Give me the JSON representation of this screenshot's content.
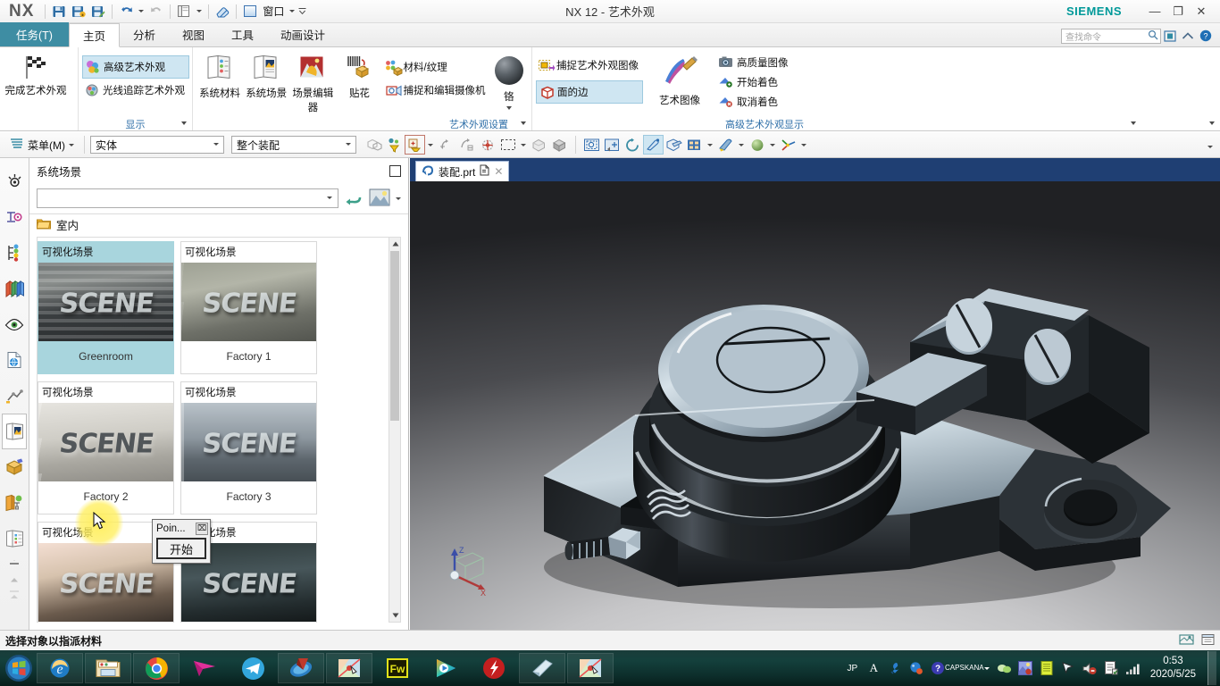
{
  "window": {
    "title": "NX 12 - 艺术外观",
    "brand": "SIEMENS",
    "app_name": "NX",
    "minimize": "—",
    "restore": "❐",
    "close": "✕"
  },
  "quick_access": [
    {
      "name": "save-icon",
      "label": "保存"
    },
    {
      "name": "save-as-icon",
      "label": "另存为"
    },
    {
      "name": "save-bookmark-icon",
      "label": "保存书签"
    },
    {
      "name": "undo-icon",
      "label": "撤销"
    },
    {
      "name": "redo-icon",
      "label": "重做"
    },
    {
      "name": "window-layout-icon",
      "label": "窗口布局"
    },
    {
      "name": "eraser-icon",
      "label": "擦除"
    }
  ],
  "window_menu": {
    "label": "窗口"
  },
  "tabs": {
    "task": "任务(T)",
    "items": [
      {
        "label": "主页",
        "active": true
      },
      {
        "label": "分析",
        "active": false
      },
      {
        "label": "视图",
        "active": false
      },
      {
        "label": "工具",
        "active": false
      },
      {
        "label": "动画设计",
        "active": false
      }
    ]
  },
  "search": {
    "placeholder": "查找命令"
  },
  "header_icons": [
    {
      "name": "full-screen-icon"
    },
    {
      "name": "collapse-ribbon-icon"
    },
    {
      "name": "help-icon"
    }
  ],
  "ribbon": {
    "groups": [
      {
        "label": "",
        "big_buttons": [
          {
            "name": "finish-studio-button",
            "label": "完成艺术外观",
            "icon": "checkered-flag-icon"
          }
        ]
      },
      {
        "label": "显示",
        "rows": [
          {
            "name": "advanced-studio-button",
            "label": "高级艺术外观",
            "icon": "spheres-icon",
            "selected": true
          },
          {
            "name": "raytrace-studio-button",
            "label": "光线追踪艺术外观",
            "icon": "raytrace-icon",
            "selected": false
          }
        ]
      },
      {
        "label": "艺术外观设置",
        "med_buttons": [
          {
            "name": "system-materials-button",
            "label": "系统材料",
            "icon": "material-library-icon"
          },
          {
            "name": "system-scenes-button",
            "label": "系统场景",
            "icon": "scene-library-icon"
          },
          {
            "name": "scene-editor-button",
            "label": "场景编辑器",
            "icon": "scene-editor-icon"
          },
          {
            "name": "decal-button",
            "label": "贴花",
            "icon": "decal-icon"
          }
        ],
        "rows": [
          {
            "name": "material-texture-button",
            "label": "材料/纹理",
            "icon": "material-texture-icon"
          },
          {
            "name": "capture-edit-camera-button",
            "label": "捕捉和编辑摄像机",
            "icon": "camera-icon"
          }
        ],
        "material_preview": {
          "name": "chrome-material-button",
          "label": "铬"
        }
      },
      {
        "label": "高级艺术外观显示",
        "rows": [
          {
            "name": "capture-studio-image-button",
            "label": "捕捉艺术外观图像",
            "icon": "capture-image-icon",
            "selected": false
          },
          {
            "name": "face-edges-button",
            "label": "面的边",
            "icon": "cube-edges-icon",
            "selected": true
          }
        ],
        "med_buttons": [
          {
            "name": "art-image-button",
            "label": "艺术图像",
            "icon": "paintbrush-icon"
          }
        ],
        "small_rows": [
          {
            "name": "high-quality-image-button",
            "label": "高质量图像",
            "icon": "hq-image-icon"
          },
          {
            "name": "start-shading-button",
            "label": "开始着色",
            "icon": "start-shading-icon"
          },
          {
            "name": "cancel-shading-button",
            "label": "取消着色",
            "icon": "cancel-shading-icon"
          }
        ]
      }
    ]
  },
  "selection_toolbar": {
    "menu_label": "菜单(M)",
    "type_filter": "实体",
    "scope_filter": "整个装配",
    "icons": [
      {
        "name": "assembly-filter-icon"
      },
      {
        "name": "feature-filter-icon"
      },
      {
        "name": "general-selection-filter-icon"
      },
      {
        "name": "snap-point-icon"
      },
      {
        "name": "snap-curve-icon"
      },
      {
        "name": "snap-center-icon"
      },
      {
        "name": "rectangle-select-icon"
      },
      {
        "name": "hidden-shade-icon"
      },
      {
        "name": "shaded-cube-icon"
      },
      {
        "name": "fit-view-icon"
      },
      {
        "name": "zoom-view-icon"
      },
      {
        "name": "rotate-view-icon"
      },
      {
        "name": "pan-view-icon"
      },
      {
        "name": "view-layout-icon"
      },
      {
        "name": "render-style-icon"
      },
      {
        "name": "scene-sphere-icon"
      },
      {
        "name": "wcs-icon"
      }
    ]
  },
  "left_rail": [
    {
      "name": "rail-item-assembly-navigator",
      "icon": "gear-outline-icon"
    },
    {
      "name": "rail-item-constraint-navigator",
      "icon": "constraint-icon"
    },
    {
      "name": "rail-item-part-navigator",
      "icon": "part-tree-icon"
    },
    {
      "name": "rail-item-reuse-library",
      "icon": "books-icon"
    },
    {
      "name": "rail-item-view-manager",
      "icon": "eye-icon"
    },
    {
      "name": "rail-item-web-browser",
      "icon": "web-page-icon"
    },
    {
      "name": "rail-item-history",
      "icon": "history-icon"
    },
    {
      "name": "rail-item-system-scene",
      "icon": "scene-panel-icon",
      "active": true
    },
    {
      "name": "rail-item-system-material",
      "icon": "material-box-icon"
    },
    {
      "name": "rail-item-roles",
      "icon": "roles-icon"
    },
    {
      "name": "rail-item-system-visual",
      "icon": "visual-panel-icon"
    }
  ],
  "panel": {
    "title": "系统场景",
    "search_value": "",
    "reload_icon": "refresh-icon",
    "view_mode_icon": "thumbnail-view-icon",
    "group_label": "室内",
    "group_icon": "folder-icon",
    "cards": [
      {
        "type": "可视化场景",
        "name": "Greenroom",
        "selected": true,
        "style": "scene-a",
        "word": "SCENE"
      },
      {
        "type": "可视化场景",
        "name": "Factory 1",
        "selected": false,
        "style": "scene-b",
        "word": "SCENE"
      },
      {
        "type": "可视化场景",
        "name": "Factory 2",
        "selected": false,
        "style": "scene-c",
        "word": "SCENE"
      },
      {
        "type": "可视化场景",
        "name": "Factory 3",
        "selected": false,
        "style": "scene-d",
        "word": "SCENE"
      },
      {
        "type": "可视化场景",
        "name": "",
        "selected": false,
        "style": "scene-e",
        "word": "SCENE"
      },
      {
        "type": "可视化场景",
        "name": "",
        "selected": false,
        "style": "scene-f",
        "word": "SCENE"
      }
    ]
  },
  "popup": {
    "title": "Poin...",
    "close": "⌧",
    "button_label": "开始"
  },
  "viewport": {
    "tab_label": "装配.prt",
    "tab_modified_icon": "modified-icon",
    "tab_close": "✕",
    "axis": {
      "z": "Z",
      "x": "X"
    }
  },
  "status": {
    "message": "选择对象以指派材料",
    "right_icons": [
      {
        "name": "screen-capture-icon"
      },
      {
        "name": "window-info-icon"
      }
    ]
  },
  "taskbar": {
    "start": "start-orb-icon",
    "apps": [
      {
        "name": "taskbar-internet-explorer",
        "icon": "ie-icon"
      },
      {
        "name": "taskbar-file-explorer",
        "icon": "explorer-icon"
      },
      {
        "name": "taskbar-chrome",
        "icon": "chrome-icon"
      },
      {
        "name": "taskbar-arrow-app",
        "icon": "pink-arrow-icon"
      },
      {
        "name": "taskbar-telegram",
        "icon": "telegram-icon"
      },
      {
        "name": "taskbar-nx-browser",
        "icon": "nx-globe-icon"
      },
      {
        "name": "taskbar-snip-tool",
        "icon": "snip-icon"
      },
      {
        "name": "taskbar-fireworks",
        "icon": "fw-icon",
        "label": "Fw"
      },
      {
        "name": "taskbar-media-player",
        "icon": "player-icon"
      },
      {
        "name": "taskbar-flash",
        "icon": "flash-icon"
      },
      {
        "name": "taskbar-nx-window",
        "icon": "nx-window-icon"
      },
      {
        "name": "taskbar-snip-tool-2",
        "icon": "snip-icon"
      }
    ],
    "tray": [
      {
        "name": "tray-ime-jp",
        "label": "JP"
      },
      {
        "name": "tray-ime-a",
        "label": "A"
      },
      {
        "name": "tray-tool-icon"
      },
      {
        "name": "tray-ime-palette-icon"
      },
      {
        "name": "tray-help-icon"
      },
      {
        "name": "tray-caps-kana",
        "line1": "CAPS",
        "line2": "KANA"
      },
      {
        "name": "tray-chat-icon"
      },
      {
        "name": "tray-picture-icon"
      },
      {
        "name": "tray-notepad-icon"
      },
      {
        "name": "tray-cursor-icon"
      },
      {
        "name": "tray-volume-muted-icon"
      },
      {
        "name": "tray-action-center-icon"
      },
      {
        "name": "tray-network-icon"
      }
    ],
    "clock_time": "0:53",
    "clock_date": "2020/5/25"
  }
}
